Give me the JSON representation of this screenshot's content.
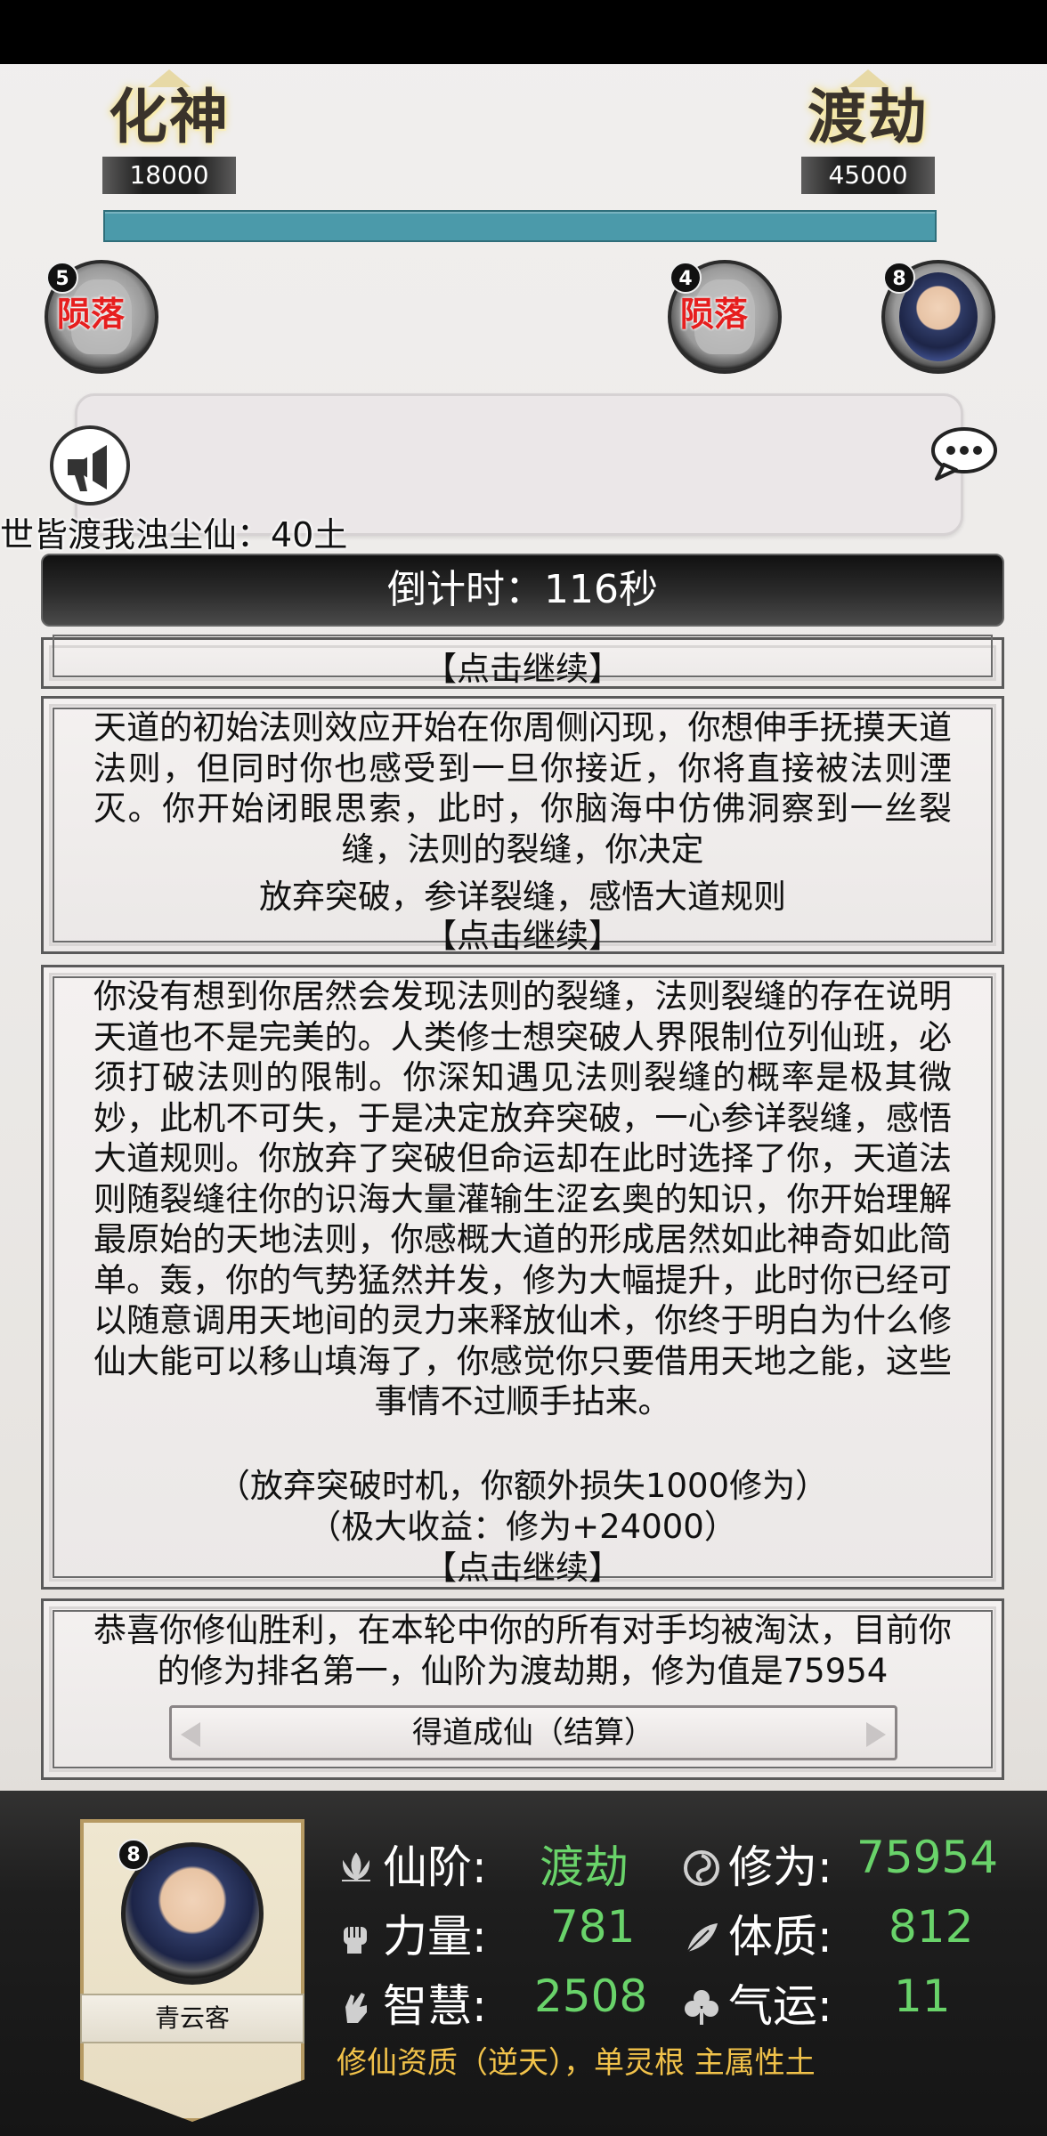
{
  "header": {
    "left_realm": "化神",
    "left_score": "18000",
    "right_realm": "渡劫",
    "right_score": "45000"
  },
  "opponents": [
    {
      "count": "5",
      "status": "陨落"
    },
    {
      "count": "4",
      "status": "陨落"
    },
    {
      "count": "8",
      "status": ""
    }
  ],
  "chat": {
    "ticker": "世皆渡我浊尘仙：40土"
  },
  "countdown": "倒计时：116秒",
  "story": {
    "continue_label": "【点击继续】",
    "panel2_text": "天道的初始法则效应开始在你周侧闪现，你想伸手抚摸天道法则，但同时你也感受到一旦你接近，你将直接被法则湮灭。你开始闭眼思索，此时，你脑海中仿佛洞察到一丝裂缝，法则的裂缝，你决定",
    "panel2_choice": "放弃突破，参详裂缝，感悟大道规则",
    "panel3_text": "你没有想到你居然会发现法则的裂缝，法则裂缝的存在说明天道也不是完美的。人类修士想突破人界限制位列仙班，必须打破法则的限制。你深知遇见法则裂缝的概率是极其微妙，此机不可失，于是决定放弃突破，一心参详裂缝，感悟大道规则。你放弃了突破但命运却在此时选择了你，天道法则随裂缝往你的识海大量灌输生涩玄奥的知识，你开始理解最原始的天地法则，你感概大道的形成居然如此神奇如此简单。轰，你的气势猛然并发，修为大幅提升，此时你已经可以随意调用天地间的灵力来释放仙术，你终于明白为什么修仙大能可以移山填海了，你感觉你只要借用天地之能，这些事情不过顺手拈来。",
    "panel3_loss": "（放弃突破时机，你额外损失1000修为）",
    "panel3_gain": "（极大收益：修为+24000）",
    "panel4_text": "恭喜你修仙胜利，在本轮中你的所有对手均被淘汰，目前你的修为排名第一，仙阶为渡劫期，修为值是75954",
    "settle_button": "得道成仙（结算）"
  },
  "player": {
    "count": "8",
    "name": "青云客",
    "stats": {
      "rank_label": "仙阶:",
      "rank_value": "渡劫",
      "cultivation_label": "修为:",
      "cultivation_value": "75954",
      "strength_label": "力量:",
      "strength_value": "781",
      "constitution_label": "体质:",
      "constitution_value": "812",
      "wisdom_label": "智慧:",
      "wisdom_value": "2508",
      "luck_label": "气运:",
      "luck_value": "11"
    },
    "aptitude": "修仙资质（逆天），单灵根 主属性土"
  },
  "colors": {
    "progress_bar": "#4b9aaa",
    "stat_value": "#69d36a",
    "choice_text": "#f5a21c",
    "fallen_text": "#e61e1e",
    "aptitude_text": "#f1c24a"
  },
  "icons": [
    "megaphone-icon",
    "chat-bubble-icon",
    "lotus-icon",
    "swirl-icon",
    "fist-icon",
    "leaf-icon",
    "hand-icon",
    "clover-icon"
  ]
}
